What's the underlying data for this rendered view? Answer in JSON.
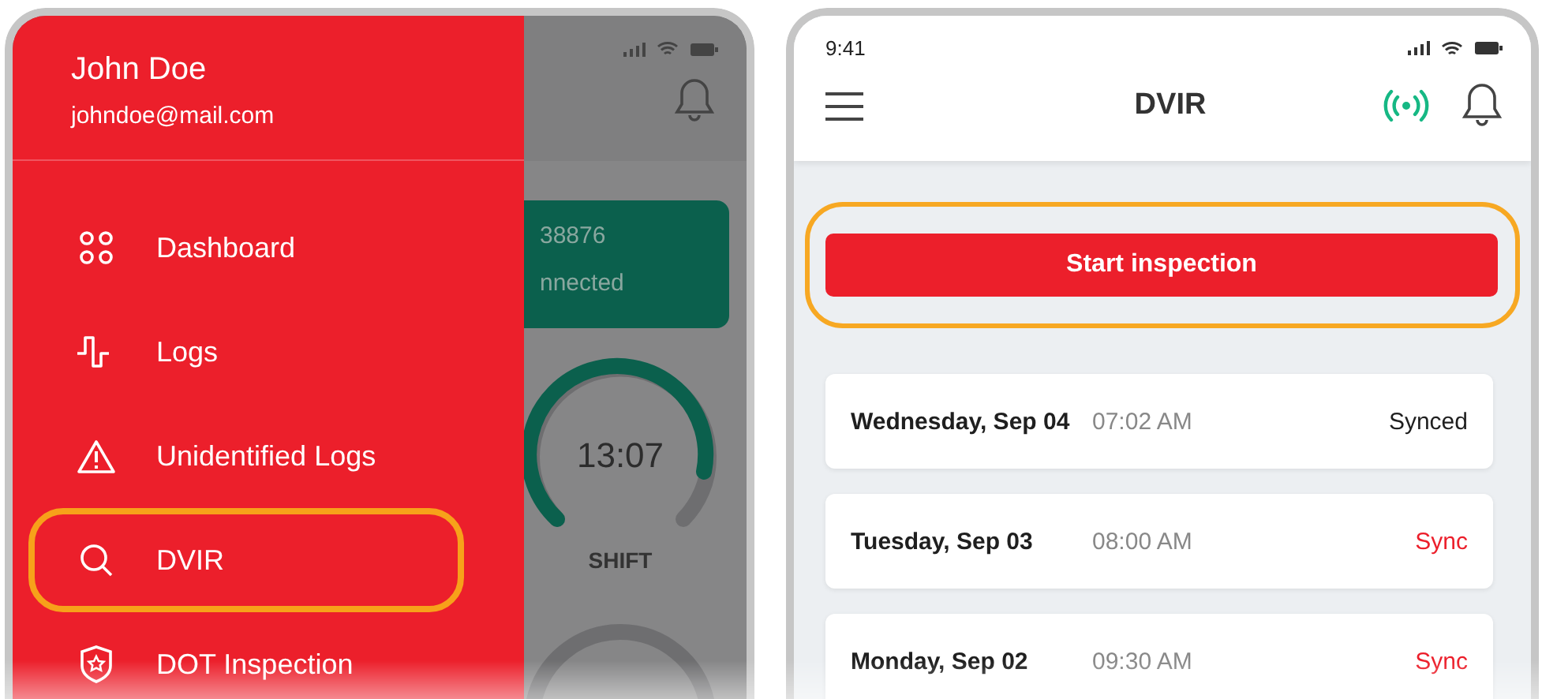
{
  "left_phone": {
    "drawer": {
      "user_name": "John Doe",
      "user_email": "johndoe@mail.com",
      "items": [
        {
          "label": "Dashboard",
          "kind": "dashboard",
          "highlighted": false
        },
        {
          "label": "Logs",
          "kind": "logs",
          "highlighted": false
        },
        {
          "label": "Unidentified Logs",
          "kind": "warning",
          "highlighted": false
        },
        {
          "label": "DVIR",
          "kind": "search",
          "highlighted": true
        },
        {
          "label": "DOT Inspection",
          "kind": "shield",
          "highlighted": false
        }
      ]
    },
    "background_screen": {
      "card_line_1": "38876",
      "card_line_2": "nnected",
      "gauge_time": "13:07",
      "gauge_label": "SHIFT"
    }
  },
  "right_phone": {
    "status_time": "9:41",
    "title": "DVIR",
    "start_button": {
      "label": "Start inspection",
      "highlighted": true
    },
    "inspections": [
      {
        "date": "Wednesday, Sep 04",
        "time": "07:02 AM",
        "status": "Synced",
        "synced": true
      },
      {
        "date": "Tuesday, Sep 03",
        "time": "08:00 AM",
        "status": "Sync",
        "synced": false
      },
      {
        "date": "Monday, Sep 02",
        "time": "09:30 AM",
        "status": "Sync",
        "synced": false
      }
    ]
  }
}
